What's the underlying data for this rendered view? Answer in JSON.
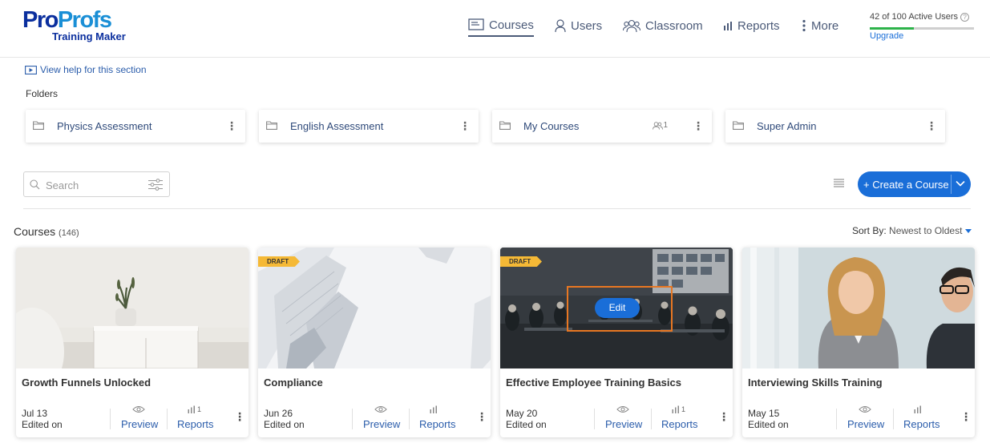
{
  "logo": {
    "brand_a": "Pro",
    "brand_b": "Profs",
    "sub": "Training Maker"
  },
  "nav": {
    "courses": "Courses",
    "users": "Users",
    "classroom": "Classroom",
    "reports": "Reports",
    "more": "More"
  },
  "license": {
    "text": "42 of 100 Active Users",
    "used": 42,
    "total": 100,
    "upgrade": "Upgrade"
  },
  "help": {
    "view_help": "View help for this section"
  },
  "folders": {
    "label": "Folders",
    "items": [
      {
        "name": "Physics Assessment",
        "count": ""
      },
      {
        "name": "English Assessment",
        "count": ""
      },
      {
        "name": "My Courses",
        "count": "1"
      },
      {
        "name": "Super Admin",
        "count": ""
      }
    ]
  },
  "toolbar": {
    "search_placeholder": "Search",
    "create_label": "+ Create a Course"
  },
  "courses": {
    "title": "Courses",
    "count": "(146)",
    "sort_label": "Sort By:",
    "sort_value": "Newest to Oldest",
    "preview_label": "Preview",
    "reports_label": "Reports",
    "edited_label": "Edited on",
    "draft_label": "DRAFT",
    "edit_label": "Edit",
    "items": [
      {
        "title": "Growth Funnels Unlocked",
        "date": "Jul 13",
        "report_count": "1",
        "draft": false
      },
      {
        "title": "Compliance",
        "date": "Jun 26",
        "report_count": "",
        "draft": true
      },
      {
        "title": "Effective Employee Training Basics",
        "date": "May 20",
        "report_count": "1",
        "draft": true
      },
      {
        "title": "Interviewing Skills Training",
        "date": "May 15",
        "report_count": "",
        "draft": false
      }
    ]
  },
  "colors": {
    "accent": "#1a6ed8",
    "progress": "#2db34a",
    "draft": "#f5b936",
    "highlight": "#e87722"
  }
}
